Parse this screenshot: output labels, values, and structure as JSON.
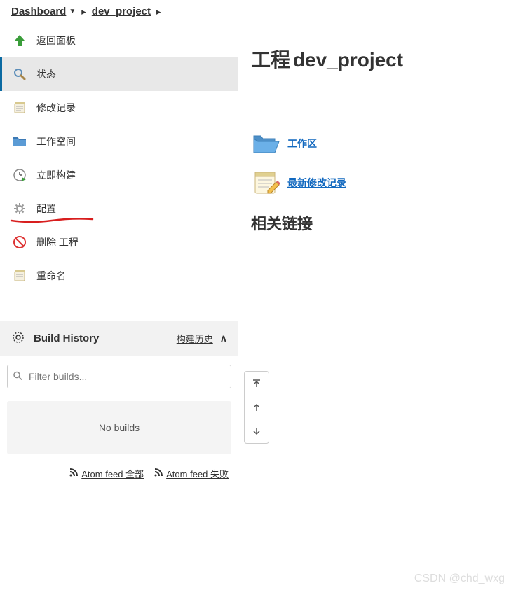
{
  "breadcrumb": {
    "root": "Dashboard",
    "project": "dev_project"
  },
  "sidebar": {
    "items": [
      {
        "label": "返回面板",
        "icon": "up-arrow-green"
      },
      {
        "label": "状态",
        "icon": "magnifier",
        "active": true
      },
      {
        "label": "修改记录",
        "icon": "notepad"
      },
      {
        "label": "工作空间",
        "icon": "folder-blue"
      },
      {
        "label": "立即构建",
        "icon": "clock-play"
      },
      {
        "label": "配置",
        "icon": "gear",
        "annotated": true
      },
      {
        "label": "删除 工程",
        "icon": "no-entry"
      },
      {
        "label": "重命名",
        "icon": "notepad"
      }
    ]
  },
  "build_history": {
    "title": "Build History",
    "trend_label": "构建历史",
    "filter_placeholder": "Filter builds...",
    "empty_text": "No builds",
    "feeds": [
      {
        "label": "Atom feed 全部"
      },
      {
        "label": "Atom feed 失败"
      }
    ]
  },
  "main": {
    "title_prefix": "工程",
    "title_name": "dev_project",
    "links": [
      {
        "label": "工作区",
        "icon": "folder-open"
      },
      {
        "label": "最新修改记录",
        "icon": "notepad-pencil"
      }
    ],
    "related_title": "相关链接"
  },
  "watermark": "CSDN @chd_wxg"
}
